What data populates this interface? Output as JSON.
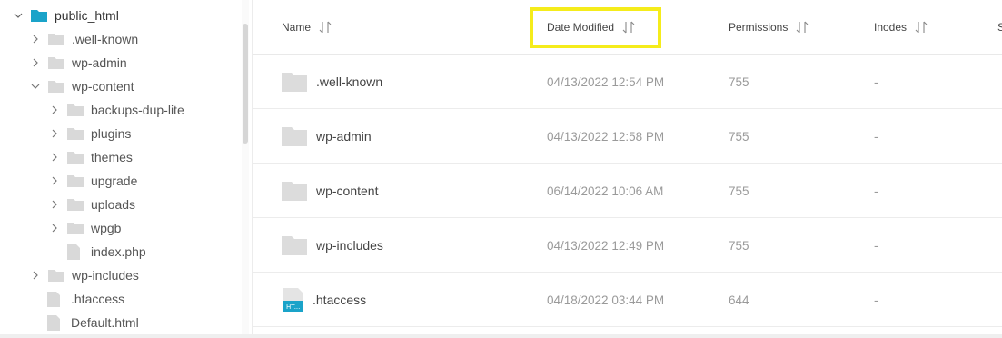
{
  "tree": {
    "items": [
      {
        "label": "public_html",
        "chevron": "down",
        "icon": "folder-root"
      },
      {
        "label": ".well-known",
        "chevron": "right",
        "icon": "folder"
      },
      {
        "label": "wp-admin",
        "chevron": "right",
        "icon": "folder"
      },
      {
        "label": "wp-content",
        "chevron": "down",
        "icon": "folder"
      },
      {
        "label": "backups-dup-lite",
        "chevron": "right",
        "icon": "folder"
      },
      {
        "label": "plugins",
        "chevron": "right",
        "icon": "folder"
      },
      {
        "label": "themes",
        "chevron": "right",
        "icon": "folder"
      },
      {
        "label": "upgrade",
        "chevron": "right",
        "icon": "folder"
      },
      {
        "label": "uploads",
        "chevron": "right",
        "icon": "folder"
      },
      {
        "label": "wpgb",
        "chevron": "right",
        "icon": "folder"
      },
      {
        "label": "index.php",
        "chevron": "none",
        "icon": "file"
      },
      {
        "label": "wp-includes",
        "chevron": "right",
        "icon": "folder"
      },
      {
        "label": ".htaccess",
        "chevron": "none",
        "icon": "file"
      },
      {
        "label": "Default.html",
        "chevron": "none",
        "icon": "file"
      }
    ]
  },
  "table": {
    "headers": {
      "name": "Name",
      "date": "Date Modified",
      "permissions": "Permissions",
      "inodes": "Inodes",
      "size": "S"
    },
    "rows": [
      {
        "name": ".well-known",
        "date": "04/13/2022 12:54 PM",
        "permissions": "755",
        "inodes": "-",
        "icon": "folder"
      },
      {
        "name": "wp-admin",
        "date": "04/13/2022 12:58 PM",
        "permissions": "755",
        "inodes": "-",
        "icon": "folder"
      },
      {
        "name": "wp-content",
        "date": "06/14/2022 10:06 AM",
        "permissions": "755",
        "inodes": "-",
        "icon": "folder"
      },
      {
        "name": "wp-includes",
        "date": "04/13/2022 12:49 PM",
        "permissions": "755",
        "inodes": "-",
        "icon": "folder"
      },
      {
        "name": ".htaccess",
        "date": "04/18/2022 03:44 PM",
        "permissions": "644",
        "inodes": "-",
        "icon": "htaccess-file"
      }
    ]
  },
  "colors": {
    "root_folder": "#1aa3c9",
    "folder": "#d9d9d9",
    "highlight": "#f5ec1b",
    "htaccess_badge": "#1aa3c9"
  }
}
